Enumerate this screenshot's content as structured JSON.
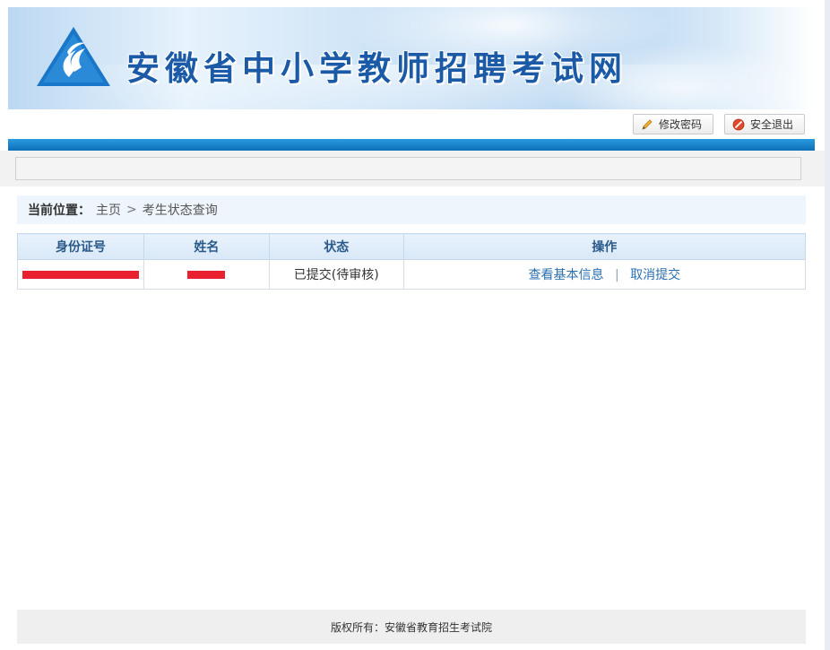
{
  "header": {
    "site_title": "安徽省中小学教师招聘考试网",
    "buttons": {
      "change_password": "修改密码",
      "logout": "安全退出"
    }
  },
  "breadcrumb": {
    "label": "当前位置：",
    "home": "主页",
    "separator": ">",
    "current": "考生状态查询"
  },
  "table": {
    "headers": [
      "身份证号",
      "姓名",
      "状态",
      "操作"
    ],
    "rows": [
      {
        "id_number": "",
        "name": "",
        "status": "已提交(待审核)",
        "actions": [
          "查看基本信息",
          "取消提交"
        ],
        "action_separator": "|"
      }
    ]
  },
  "footer": {
    "copyright": "版权所有：安徽省教育招生考试院"
  },
  "colors": {
    "brand_blue": "#1a5aa6",
    "nav_bar": "#0d6fb8",
    "link": "#2b6fb0",
    "redaction": "#e8202f"
  },
  "icons": {
    "change_password": "pencil-icon",
    "logout": "no-entry-icon"
  }
}
